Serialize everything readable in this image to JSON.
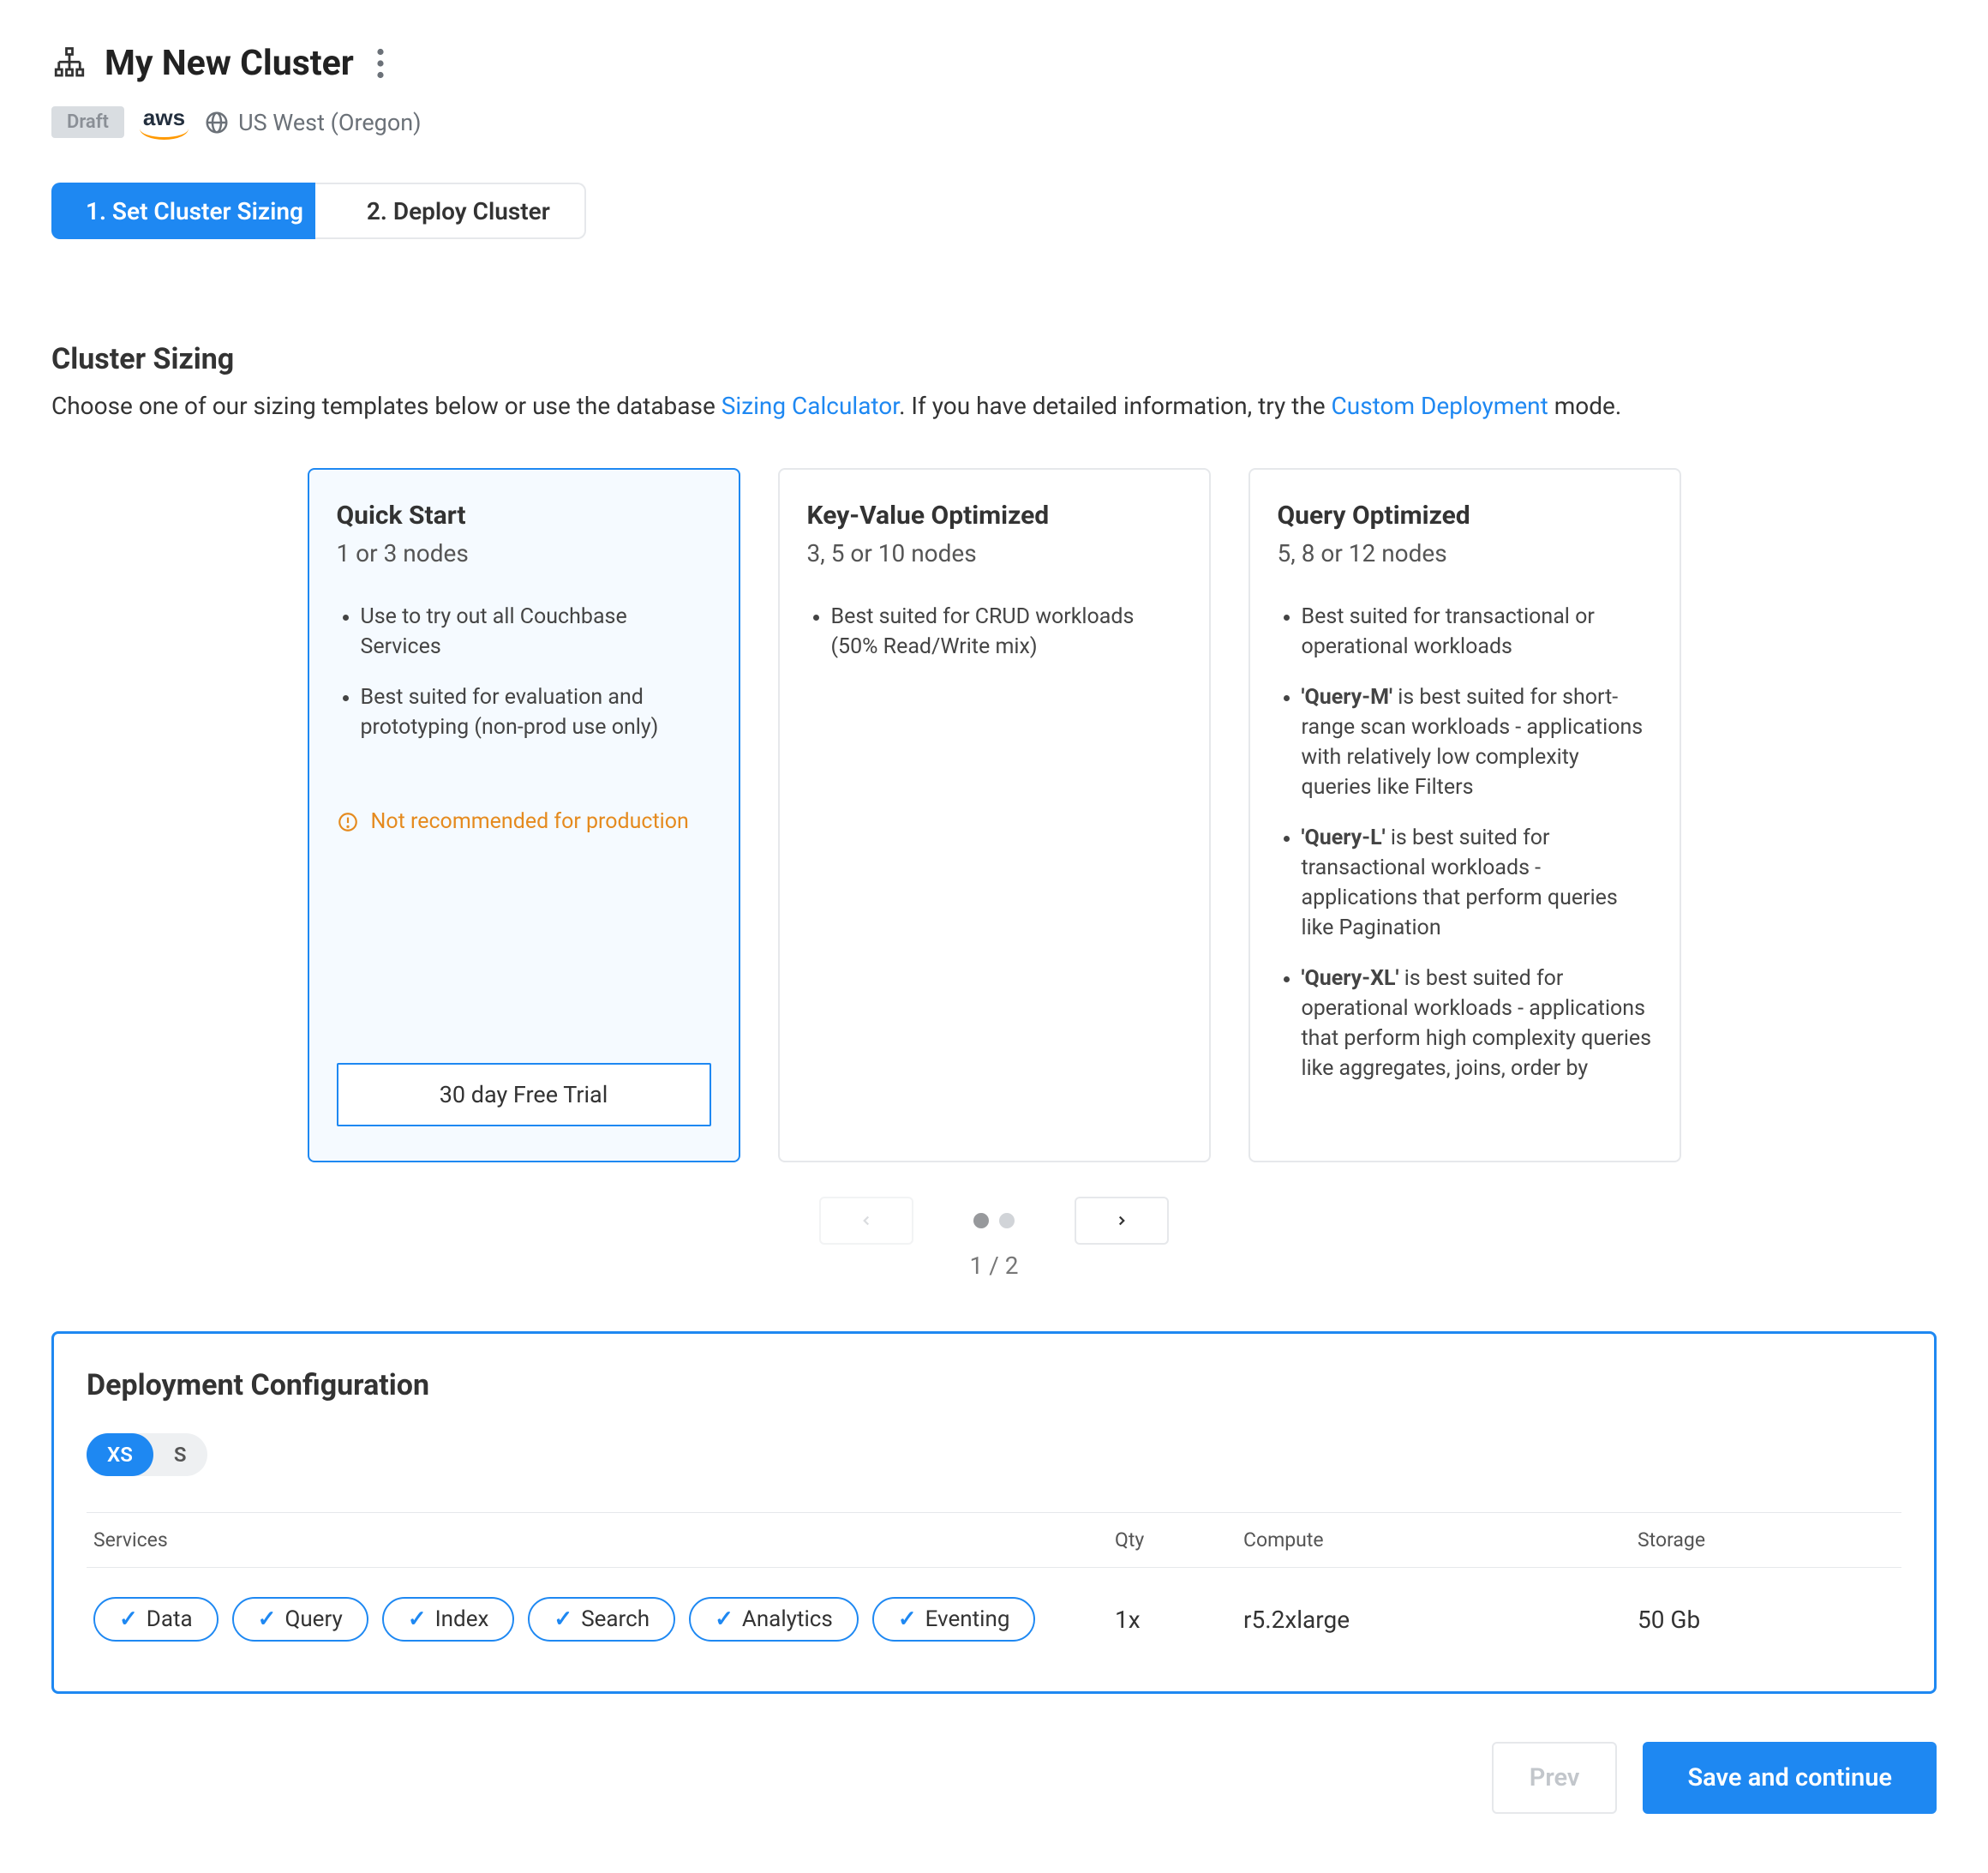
{
  "header": {
    "title": "My New Cluster",
    "status_badge": "Draft",
    "provider": "aws",
    "region": "US West (Oregon)"
  },
  "steps": {
    "step1": "1. Set Cluster Sizing",
    "step2": "2. Deploy Cluster"
  },
  "sizing": {
    "title": "Cluster Sizing",
    "desc_pre": "Choose one of our sizing templates below or use the database ",
    "link1": "Sizing Calculator",
    "desc_mid": ". If you have detailed information, try the ",
    "link2": "Custom Deployment",
    "desc_post": " mode."
  },
  "cards": [
    {
      "title": "Quick Start",
      "sub": "1 or 3 nodes",
      "bullets": [
        "Use to try out all Couchbase Services",
        "Best suited for evaluation and prototyping (non-prod use only)"
      ],
      "warning": "Not recommended for production",
      "trial_label": "30 day Free Trial"
    },
    {
      "title": "Key-Value Optimized",
      "sub": "3, 5 or 10 nodes",
      "bullets": [
        "Best suited for CRUD workloads (50% Read/Write mix)"
      ]
    },
    {
      "title": "Query Optimized",
      "sub": "5, 8 or 12 nodes",
      "bullets_rich": [
        {
          "pre": "Best suited for transactional or operational workloads"
        },
        {
          "b": "'Query-M'",
          "rest": " is best suited for short-range scan workloads - applications with relatively low complexity queries like Filters"
        },
        {
          "b": "'Query-L'",
          "rest": " is best suited for transactional workloads - applications that perform queries like Pagination"
        },
        {
          "b": "'Query-XL'",
          "rest": " is best suited for operational workloads - applications that perform high complexity queries like aggregates, joins, order by"
        }
      ]
    }
  ],
  "pager": {
    "current": "1",
    "sep": " / ",
    "total": "2"
  },
  "deploy": {
    "title": "Deployment Configuration",
    "sizes": [
      "XS",
      "S"
    ],
    "headers": {
      "services": "Services",
      "qty": "Qty",
      "compute": "Compute",
      "storage": "Storage"
    },
    "services": [
      "Data",
      "Query",
      "Index",
      "Search",
      "Analytics",
      "Eventing"
    ],
    "row": {
      "qty": "1x",
      "compute": "r5.2xlarge",
      "storage": "50 Gb"
    }
  },
  "footer": {
    "prev": "Prev",
    "save": "Save and continue"
  }
}
